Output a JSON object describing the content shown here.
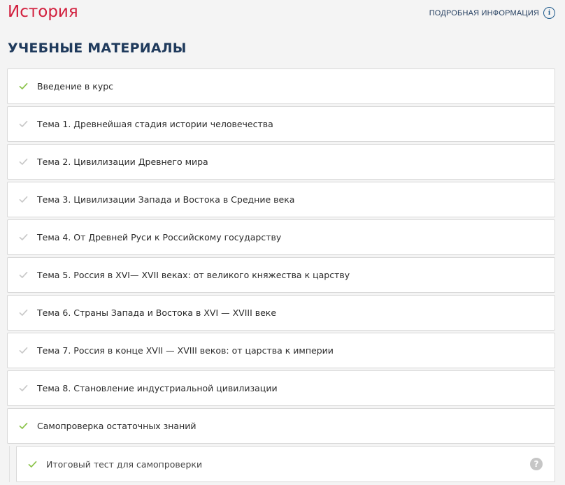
{
  "header": {
    "course_title": "История",
    "more_info_label": "ПОДРОБНАЯ ИНФОРМАЦИЯ",
    "more_info_icon": "info-icon"
  },
  "section": {
    "title": "УЧЕБНЫЕ МАТЕРИАЛЫ"
  },
  "colors": {
    "accent_red": "#d2203e",
    "heading_navy": "#1f3a5c",
    "check_done": "#8bc34a",
    "check_pending": "#c9c9c9"
  },
  "materials": [
    {
      "label": "Введение в курс",
      "status": "done"
    },
    {
      "label": "Тема 1. Древнейшая стадия истории человечества",
      "status": "pending"
    },
    {
      "label": "Тема 2. Цивилизации Древнего мира",
      "status": "pending"
    },
    {
      "label": "Тема 3. Цивилизации Запада и Востока в Средние века",
      "status": "pending"
    },
    {
      "label": "Тема 4. От Древней Руси к Российскому государству",
      "status": "pending"
    },
    {
      "label": "Тема 5. Россия в XVI— XVII веках: от великого княжества к царству",
      "status": "pending"
    },
    {
      "label": "Тема 6. Страны Запада и Востока в XVI — XVIII веке",
      "status": "pending"
    },
    {
      "label": "Тема 7. Россия в конце XVII — XVIII веков: от царства к империи",
      "status": "pending"
    },
    {
      "label": "Тема 8. Становление индустриальной цивилизации",
      "status": "pending"
    },
    {
      "label": "Самопроверка остаточных знаний",
      "status": "done"
    }
  ],
  "subitem": {
    "label": "Итоговый тест для самопроверки",
    "status": "done",
    "help_icon": "question-icon",
    "help_glyph": "?"
  }
}
